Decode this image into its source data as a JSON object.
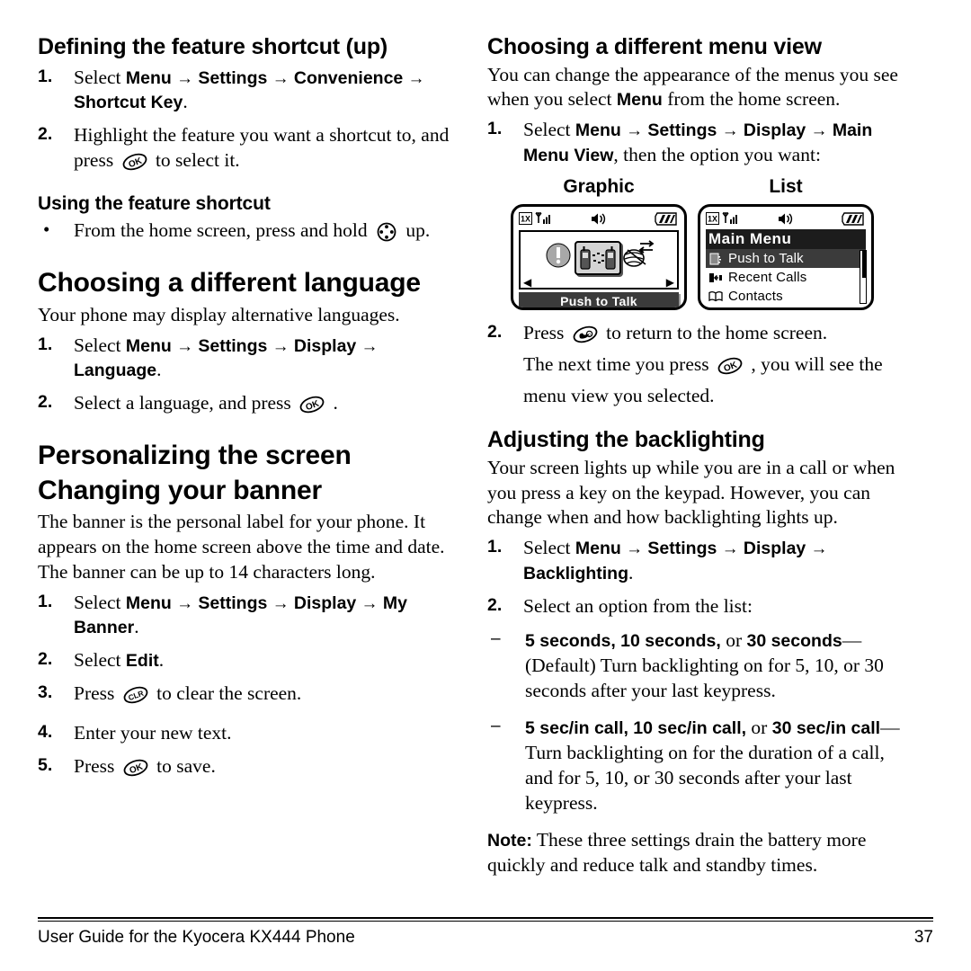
{
  "document": {
    "footer": {
      "title": "User Guide for the Kyocera KX444 Phone",
      "page_number": "37"
    }
  },
  "left_column": {
    "section_shortcut": {
      "heading": "Defining the feature shortcut (up)",
      "steps": [
        {
          "num": "1.",
          "prefix": "Select ",
          "path": [
            "Menu",
            "Settings",
            "Convenience",
            "Shortcut Key"
          ],
          "suffix": "."
        },
        {
          "num": "2.",
          "text_before": "Highlight the feature you want a shortcut to, and press ",
          "icon": "ok-key-icon",
          "text_after": " to select it."
        }
      ]
    },
    "section_using_shortcut": {
      "heading": "Using the feature shortcut",
      "bullets": [
        {
          "bullet": "•",
          "text_before": "From the home screen, press and hold ",
          "icon": "navigation-key-icon",
          "text_after": " up."
        }
      ]
    },
    "section_language": {
      "heading": "Choosing a different language",
      "intro": "Your phone may display alternative languages.",
      "steps": [
        {
          "num": "1.",
          "prefix": "Select ",
          "path": [
            "Menu",
            "Settings",
            "Display",
            "Language"
          ],
          "suffix": "."
        },
        {
          "num": "2.",
          "text_before": "Select a language, and press ",
          "icon": "ok-key-icon",
          "text_after": " ."
        }
      ]
    },
    "section_personalizing": {
      "chapter_heading": "Personalizing the screen",
      "heading": "Changing your banner",
      "intro": "The banner is the personal label for your phone. It appears on the home screen above the time and date. The banner can be up to 14 characters long.",
      "steps": [
        {
          "num": "1.",
          "prefix": "Select ",
          "path": [
            "Menu",
            "Settings",
            "Display",
            "My Banner"
          ],
          "suffix": "."
        },
        {
          "num": "2.",
          "prefix": "Select ",
          "bold": "Edit",
          "suffix": "."
        },
        {
          "num": "3.",
          "text_before": "Press ",
          "icon": "clear-key-icon",
          "text_after": " to clear the screen."
        },
        {
          "num": "4.",
          "text_before": "Enter your new text.",
          "icon": "",
          "text_after": ""
        },
        {
          "num": "5.",
          "text_before": "Press ",
          "icon": "ok-key-icon",
          "text_after": " to save."
        }
      ]
    }
  },
  "right_column": {
    "section_menu_view": {
      "heading": "Choosing a different menu view",
      "intro_a": "You can change the appearance of the menus you see when you select ",
      "intro_bold": "Menu",
      "intro_b": " from the home screen.",
      "step1": {
        "num": "1.",
        "prefix": "Select ",
        "path": [
          "Menu",
          "Settings",
          "Display",
          "Main Menu View"
        ],
        "suffix": ", then the option you want:"
      },
      "figures": [
        {
          "label": "Graphic",
          "type": "graphic",
          "status_icons": [
            "1x-icon",
            "signal-icon",
            "speaker-icon",
            "battery-icon"
          ],
          "caption": "Push to Talk",
          "left_arrow": "◀",
          "right_arrow": "▶",
          "icons": [
            "alert-icon",
            "push-to-talk-icon",
            "web-icon"
          ]
        },
        {
          "label": "List",
          "type": "list",
          "status_icons": [
            "1x-icon",
            "signal-icon",
            "speaker-icon",
            "battery-icon"
          ],
          "title": "Main Menu",
          "rows": [
            {
              "icon": "push-to-talk-icon",
              "label": "Push to Talk",
              "selected": true
            },
            {
              "icon": "recent-calls-icon",
              "label": "Recent Calls",
              "selected": false
            },
            {
              "icon": "contacts-icon",
              "label": "Contacts",
              "selected": false
            }
          ]
        }
      ],
      "step2": {
        "num": "2.",
        "text_before": "Press ",
        "icon": "end-key-icon",
        "text_after": " to return to the home screen.",
        "line2_before": "The next time you press ",
        "line2_icon": "ok-key-icon",
        "line2_after": " , you will see the menu view you selected."
      }
    },
    "section_backlighting": {
      "heading": "Adjusting the backlighting",
      "intro": "Your screen lights up while you are in a call or when you press a key on the keypad. However, you can change when and how backlighting lights up.",
      "steps": [
        {
          "num": "1.",
          "prefix": "Select ",
          "path": [
            "Menu",
            "Settings",
            "Display",
            "Backlighting"
          ],
          "suffix": "."
        },
        {
          "num": "2.",
          "text": "Select an option from the list:"
        }
      ],
      "options": [
        {
          "dash": "–",
          "bold_parts": [
            "5 seconds,",
            "10 seconds,",
            "30 seconds"
          ],
          "connector_1": " ",
          "connector_2": " or ",
          "description": "—(Default) Turn backlighting on for 5, 10, or 30 seconds after your last keypress."
        },
        {
          "dash": "–",
          "bold_parts": [
            "5 sec/in call,",
            "10 sec/in call,",
            "30 sec/",
            "in call"
          ],
          "connector_1": " ",
          "connector_2": " or ",
          "description": "—Turn backlighting on for the duration of a call, and for 5, 10, or 30 seconds after your last keypress."
        }
      ],
      "note": {
        "label": "Note:",
        "text": " These three settings drain the battery more quickly and reduce talk and standby times."
      }
    }
  }
}
